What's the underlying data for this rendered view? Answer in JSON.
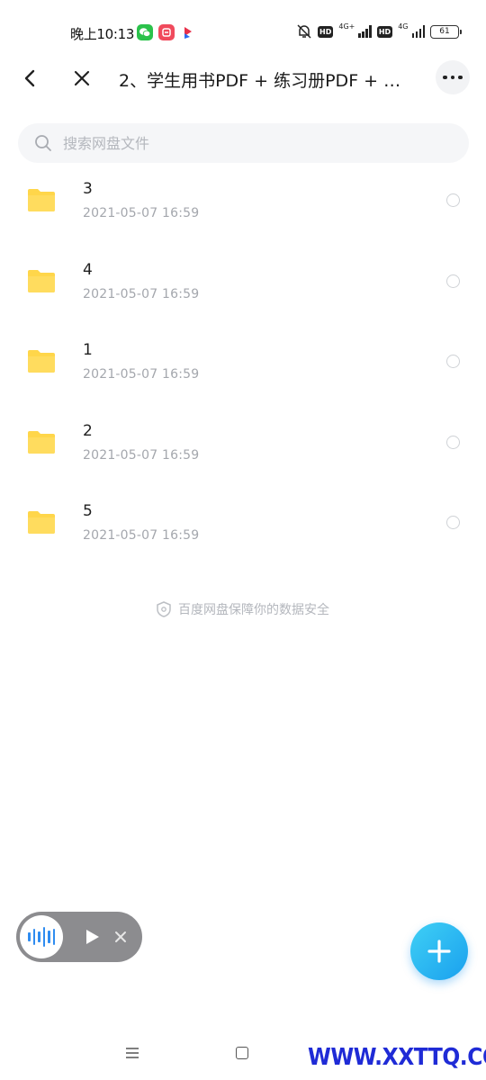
{
  "status_bar": {
    "time": "晚上10:13",
    "battery": "61",
    "net1": "4G+",
    "net2": "4G",
    "hd": "HD"
  },
  "header": {
    "title": "2、学生用书PDF + 练习册PDF + …"
  },
  "search": {
    "placeholder": "搜索网盘文件"
  },
  "files": [
    {
      "name": "3",
      "date": "2021-05-07  16:59"
    },
    {
      "name": "4",
      "date": "2021-05-07  16:59"
    },
    {
      "name": "1",
      "date": "2021-05-07  16:59"
    },
    {
      "name": "2",
      "date": "2021-05-07  16:59"
    },
    {
      "name": "5",
      "date": "2021-05-07  16:59"
    }
  ],
  "footer_note": "百度网盘保障你的数据安全",
  "watermark": "WWW.XXTTQ.COM",
  "colors": {
    "folder": "#ffd64a",
    "accent": "#1aa0ee"
  }
}
